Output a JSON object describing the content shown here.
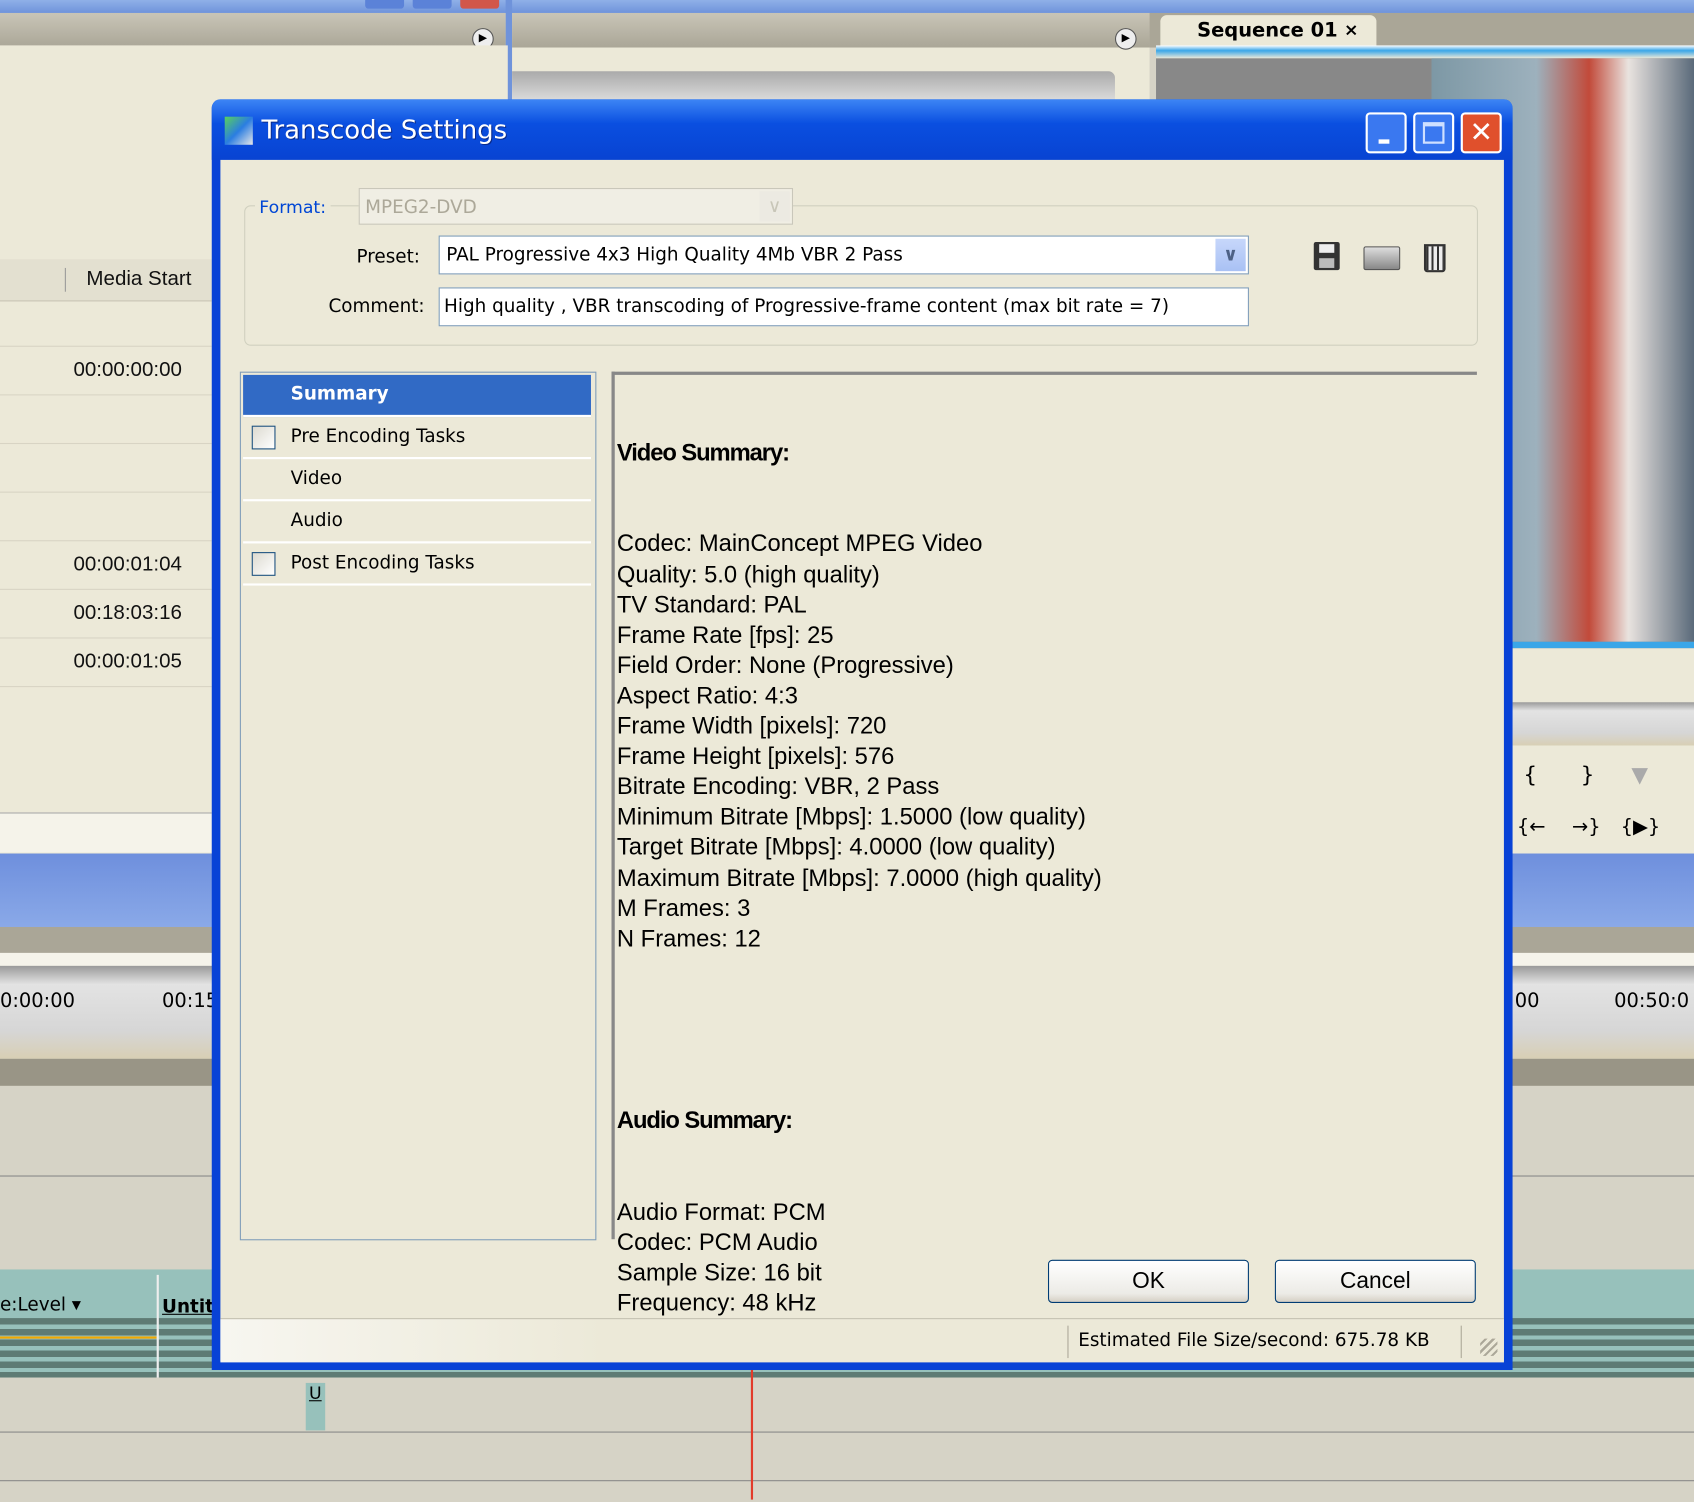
{
  "background": {
    "project_panel": {
      "column_header": "Media Start",
      "timecodes": [
        "00:00:00:00",
        "00:00:01:04",
        "00:18:03:16",
        "00:00:01:05"
      ]
    },
    "monitor_tab": {
      "label": "Sequence 01",
      "close": "×"
    },
    "timeline": {
      "ruler_left": [
        "0:00:00",
        "00:15"
      ],
      "ruler_right": [
        "00",
        "00:50:0"
      ],
      "track_menu": "e:Level ▾",
      "clip_label": "Untitl",
      "marker": "U"
    }
  },
  "dialog": {
    "title": "Transcode Settings",
    "format": {
      "label": "Format:",
      "value": "MPEG2-DVD"
    },
    "preset": {
      "label": "Preset:",
      "value": "PAL Progressive 4x3 High Quality 4Mb VBR 2 Pass"
    },
    "comment": {
      "label": "Comment:",
      "value": "High quality , VBR transcoding of Progressive-frame content (max bit rate = 7)"
    },
    "nav": [
      {
        "label": "Summary",
        "selected": true,
        "checkbox": false
      },
      {
        "label": "Pre Encoding Tasks",
        "selected": false,
        "checkbox": true,
        "checked": false
      },
      {
        "label": "Video",
        "selected": false,
        "checkbox": false
      },
      {
        "label": "Audio",
        "selected": false,
        "checkbox": false
      },
      {
        "label": "Post Encoding Tasks",
        "selected": false,
        "checkbox": true,
        "checked": false
      }
    ],
    "summary": {
      "video_heading": "Video Summary:",
      "video_lines": [
        "Codec: MainConcept MPEG Video",
        "Quality: 5.0 (high quality)",
        "TV Standard: PAL",
        "Frame Rate [fps]: 25",
        "Field Order: None (Progressive)",
        "Aspect Ratio: 4:3",
        "Frame Width [pixels]: 720",
        "Frame Height [pixels]: 576",
        "Bitrate Encoding: VBR, 2 Pass",
        "Minimum Bitrate [Mbps]: 1.5000 (low quality)",
        "Target Bitrate [Mbps]: 4.0000 (low quality)",
        "Maximum Bitrate [Mbps]: 7.0000 (high quality)",
        "M Frames: 3",
        "N Frames: 12"
      ],
      "audio_heading": "Audio Summary:",
      "audio_lines": [
        "Audio Format: PCM",
        "Codec: PCM Audio",
        "Sample Size: 16 bit",
        "Frequency: 48 kHz"
      ]
    },
    "ok_label": "OK",
    "cancel_label": "Cancel",
    "status": "Estimated File Size/second: 675.78 KB"
  }
}
